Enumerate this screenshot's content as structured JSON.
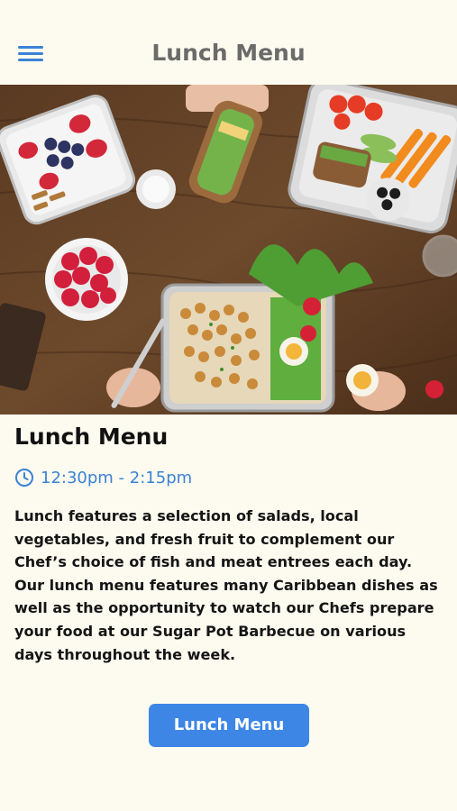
{
  "header": {
    "title": "Lunch Menu",
    "menu_icon": "hamburger-menu-icon"
  },
  "hero": {
    "image_alt": "lunch-spread-photo"
  },
  "content": {
    "title": "Lunch Menu",
    "time_icon": "clock-icon",
    "time": "12:30pm - 2:15pm",
    "description": "Lunch features a selection of salads, local vegetables, and fresh fruit to complement our Chef’s choice of fish and meat entrees each day. Our lunch menu features many Caribbean dishes as well as the opportunity to watch our Chefs prepare your food at our Sugar Pot Barbecue on various days throughout the week."
  },
  "cta": {
    "label": "Lunch Menu"
  },
  "colors": {
    "background": "#fdfbef",
    "accent": "#3d86e6",
    "time_text": "#3b82d6",
    "header_title": "#6b6b6b"
  }
}
